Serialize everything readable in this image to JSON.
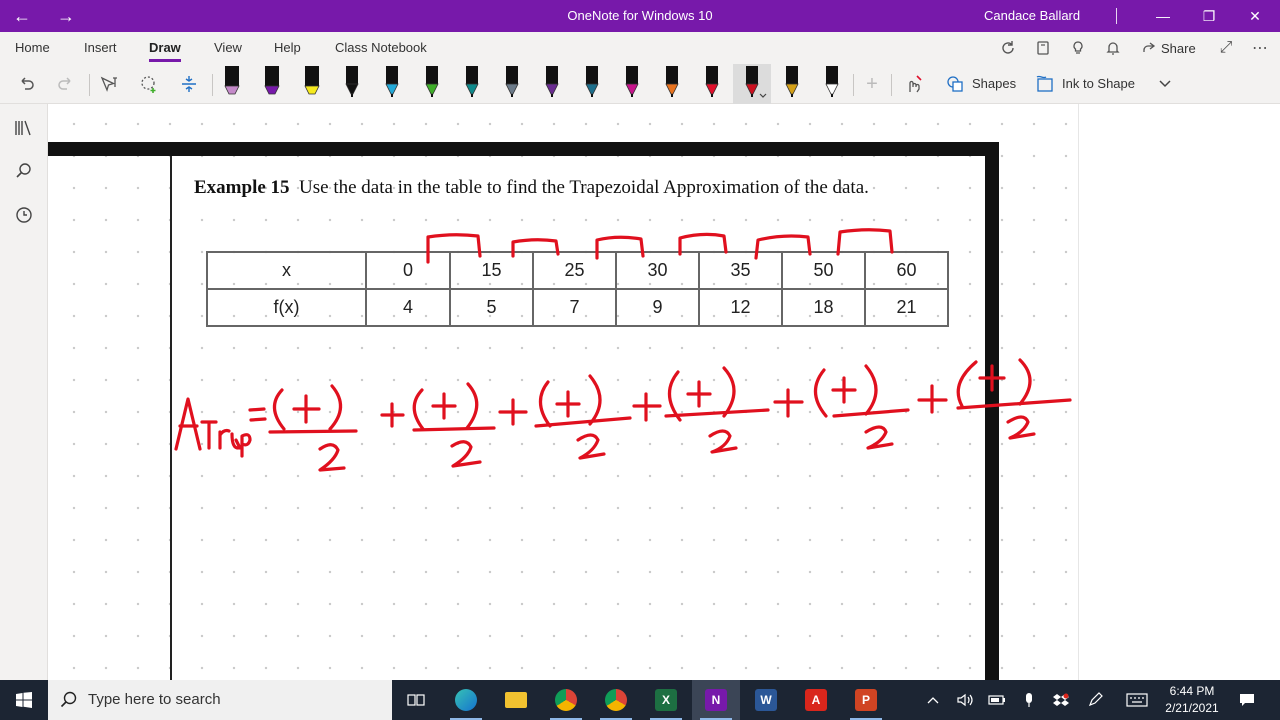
{
  "window": {
    "title": "OneNote for Windows 10",
    "user": "Candace Ballard"
  },
  "ribbon": {
    "tabs": [
      "Home",
      "Insert",
      "Draw",
      "View",
      "Help",
      "Class Notebook"
    ],
    "active_tab": "Draw",
    "share_label": "Share"
  },
  "toolbar": {
    "shapes_label": "Shapes",
    "ink_to_shape_label": "Ink to Shape",
    "pens": [
      {
        "color": "#c48ac9",
        "kind": "highlighter"
      },
      {
        "color": "#7719aa",
        "kind": "highlighter"
      },
      {
        "color": "#f6ea1d",
        "kind": "highlighter"
      },
      {
        "color": "#111111",
        "kind": "pen"
      },
      {
        "color": "#23a9d8",
        "kind": "pen"
      },
      {
        "color": "#3fae2a",
        "kind": "pen"
      },
      {
        "color": "#0f8a8c",
        "kind": "pen"
      },
      {
        "color": "#6c7b8a",
        "kind": "pen"
      },
      {
        "color": "#6a2c91",
        "kind": "pen"
      },
      {
        "color": "#1d6f8c",
        "kind": "pen"
      },
      {
        "color": "#c7158c",
        "kind": "pen"
      },
      {
        "color": "#e8731f",
        "kind": "pen"
      },
      {
        "color": "#e0102c",
        "kind": "pen"
      },
      {
        "color": "#cc1020",
        "kind": "pen",
        "selected": true
      },
      {
        "color": "#d4a017",
        "kind": "pen"
      },
      {
        "color": "#ffffff",
        "kind": "pen"
      }
    ]
  },
  "page": {
    "example_label": "Example 15",
    "prompt_text": "Use the data in the table to find the Trapezoidal Approximation of the data.",
    "table": {
      "x_header": "x",
      "fx_header": "f(x)",
      "x_values": [
        "0",
        "15",
        "25",
        "30",
        "35",
        "50",
        "60"
      ],
      "fx_values": [
        "4",
        "5",
        "7",
        "9",
        "12",
        "18",
        "21"
      ]
    },
    "ink_color": "#e0101e"
  },
  "taskbar": {
    "search_placeholder": "Type here to search",
    "time": "6:44 PM",
    "date": "2/21/2021"
  }
}
